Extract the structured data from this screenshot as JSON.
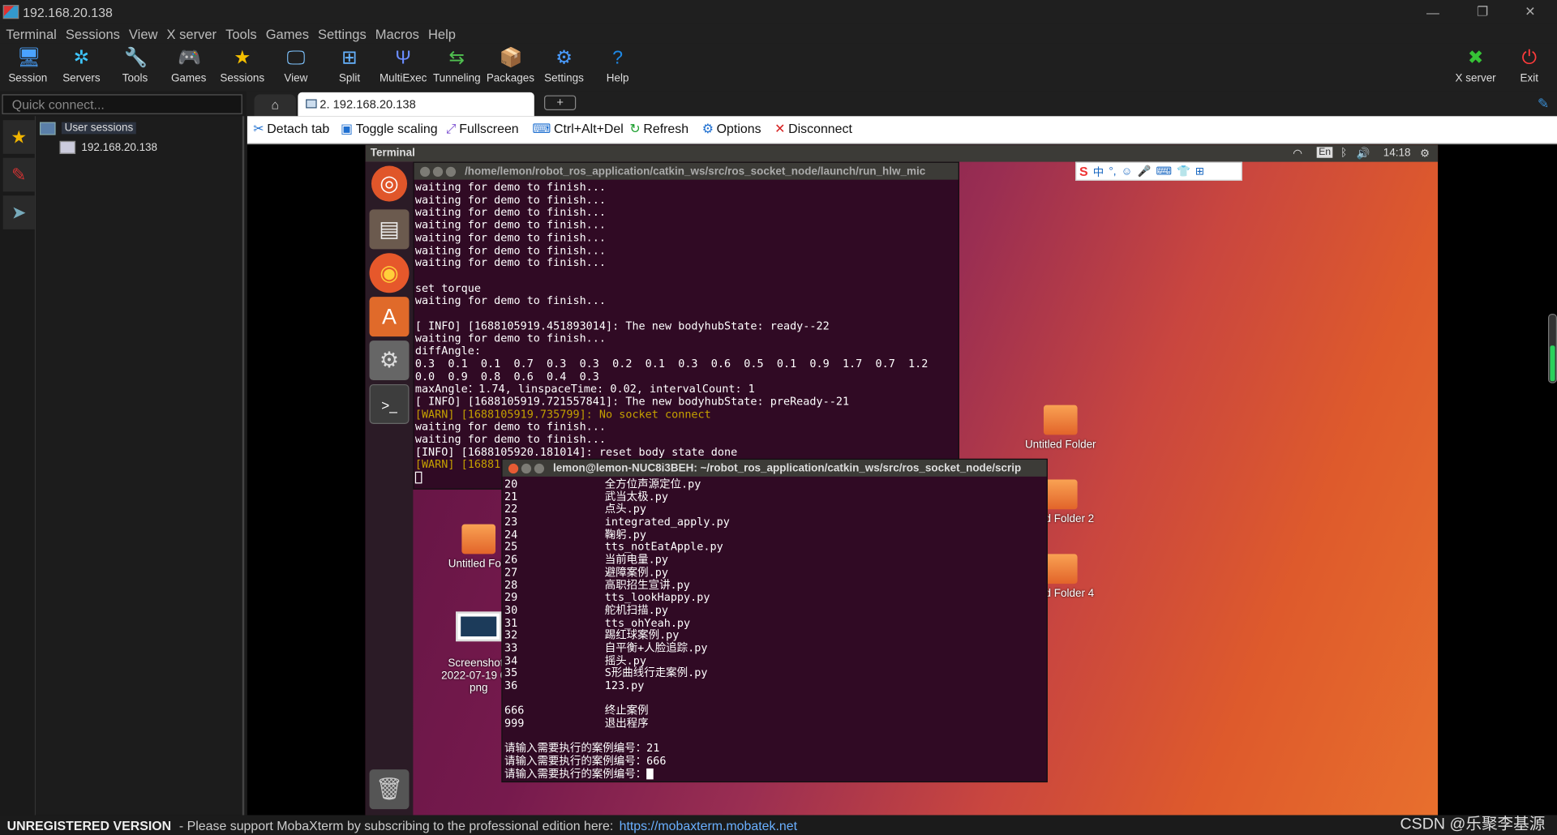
{
  "window": {
    "title": "192.168.20.138",
    "controls": [
      "—",
      "❐",
      "✕"
    ]
  },
  "menu": [
    "Terminal",
    "Sessions",
    "View",
    "X server",
    "Tools",
    "Games",
    "Settings",
    "Macros",
    "Help"
  ],
  "toolbar": [
    {
      "label": "Session",
      "icon": "session-icon",
      "glyph": "🖥"
    },
    {
      "label": "Servers",
      "icon": "servers-icon",
      "glyph": "✲"
    },
    {
      "label": "Tools",
      "icon": "tools-icon",
      "glyph": "🔧"
    },
    {
      "label": "Games",
      "icon": "games-icon",
      "glyph": "🎮"
    },
    {
      "label": "Sessions",
      "icon": "star-icon",
      "glyph": "★"
    },
    {
      "label": "View",
      "icon": "view-icon",
      "glyph": "🖵"
    },
    {
      "label": "Split",
      "icon": "split-icon",
      "glyph": "⊞"
    },
    {
      "label": "MultiExec",
      "icon": "multiexec-icon",
      "glyph": "Ψ"
    },
    {
      "label": "Tunneling",
      "icon": "tunneling-icon",
      "glyph": "⇆"
    },
    {
      "label": "Packages",
      "icon": "packages-icon",
      "glyph": "📦"
    },
    {
      "label": "Settings",
      "icon": "settings-icon",
      "glyph": "⚙"
    },
    {
      "label": "Help",
      "icon": "help-icon",
      "glyph": "?"
    }
  ],
  "toolbar_right": [
    {
      "label": "X server",
      "icon": "x-server-icon",
      "glyph": "✖"
    },
    {
      "label": "Exit",
      "icon": "exit-icon",
      "glyph": "⏻"
    }
  ],
  "quick_connect": {
    "placeholder": "Quick connect..."
  },
  "tabs": {
    "home": "⌂",
    "session": "2. 192.168.20.138",
    "plus": "+"
  },
  "sessions_panel": {
    "root": "User sessions",
    "items": [
      "192.168.20.138"
    ]
  },
  "session_toolbar": [
    {
      "label": "Detach tab",
      "glyph": "✂",
      "color": "#1e6fd0"
    },
    {
      "label": "Toggle scaling",
      "glyph": "▣",
      "color": "#1e6fd0"
    },
    {
      "label": "Fullscreen",
      "glyph": "⤢",
      "color": "#7b4fd0"
    },
    {
      "label": "Ctrl+Alt+Del",
      "glyph": "⌨",
      "color": "#1e6fd0"
    },
    {
      "label": "Refresh",
      "glyph": "↻",
      "color": "#1a9e2c"
    },
    {
      "label": "Options",
      "glyph": "⚙",
      "color": "#1e6fd0"
    },
    {
      "label": "Disconnect",
      "glyph": "✕",
      "color": "#d62020"
    }
  ],
  "remote": {
    "topbar_title": "Terminal",
    "indicators": {
      "lang": "En",
      "time": "14:18"
    },
    "ime": [
      "中",
      "°,",
      "☺",
      "🎤",
      "⌨",
      "👕",
      "⊞"
    ],
    "desktop_icons": [
      {
        "label": "Untitled Folder"
      },
      {
        "label": "ed Folder 2"
      },
      {
        "label": "ed Folder 4"
      },
      {
        "label": "Untitled Folc"
      },
      {
        "label": "Screenshot f\n2022-07-19 09-\npng"
      }
    ],
    "terminal1": {
      "title": "/home/lemon/robot_ros_application/catkin_ws/src/ros_socket_node/launch/run_hlw_mic",
      "lines": [
        {
          "t": "waiting for demo to finish..."
        },
        {
          "t": "waiting for demo to finish..."
        },
        {
          "t": "waiting for demo to finish..."
        },
        {
          "t": "waiting for demo to finish..."
        },
        {
          "t": "waiting for demo to finish..."
        },
        {
          "t": "waiting for demo to finish..."
        },
        {
          "t": "waiting for demo to finish..."
        },
        {
          "t": ""
        },
        {
          "t": "set torque"
        },
        {
          "t": "waiting for demo to finish..."
        },
        {
          "t": ""
        },
        {
          "t": "[ INFO] [1688105919.451893014]: The new bodyhubState: ready--22"
        },
        {
          "t": "waiting for demo to finish..."
        },
        {
          "t": "diffAngle:"
        },
        {
          "t": "0.3  0.1  0.1  0.7  0.3  0.3  0.2  0.1  0.3  0.6  0.5  0.1  0.9  1.7  0.7  1.2"
        },
        {
          "t": "0.0  0.9  0.8  0.6  0.4  0.3"
        },
        {
          "t": "maxAngle：1.74, linspaceTime: 0.02, intervalCount: 1"
        },
        {
          "t": "[ INFO] [1688105919.721557841]: The new bodyhubState: preReady--21"
        },
        {
          "t": "[WARN] [1688105919.735799]: No socket connect",
          "warn": true
        },
        {
          "t": "waiting for demo to finish..."
        },
        {
          "t": "waiting for demo to finish..."
        },
        {
          "t": "[INFO] [1688105920.181014]: reset body state done"
        },
        {
          "t": "[WARN] [16881",
          "warn": true
        }
      ]
    },
    "terminal2": {
      "title": "lemon@lemon-NUC8i3BEH: ~/robot_ros_application/catkin_ws/src/ros_socket_node/scrip",
      "rows": [
        {
          "n": "20",
          "name": "全方位声源定位.py"
        },
        {
          "n": "21",
          "name": "武当太极.py"
        },
        {
          "n": "22",
          "name": "点头.py"
        },
        {
          "n": "23",
          "name": "integrated_apply.py"
        },
        {
          "n": "24",
          "name": "鞠躬.py"
        },
        {
          "n": "25",
          "name": "tts_notEatApple.py"
        },
        {
          "n": "26",
          "name": "当前电量.py"
        },
        {
          "n": "27",
          "name": "避障案例.py"
        },
        {
          "n": "28",
          "name": "高职招生宣讲.py"
        },
        {
          "n": "29",
          "name": "tts_lookHappy.py"
        },
        {
          "n": "30",
          "name": "舵机扫描.py"
        },
        {
          "n": "31",
          "name": "tts_ohYeah.py"
        },
        {
          "n": "32",
          "name": "踢红球案例.py"
        },
        {
          "n": "33",
          "name": "自平衡+人脸追踪.py"
        },
        {
          "n": "34",
          "name": "摇头.py"
        },
        {
          "n": "35",
          "name": "S形曲线行走案例.py"
        },
        {
          "n": "36",
          "name": "123.py"
        },
        {
          "n": "",
          "name": ""
        },
        {
          "n": "666",
          "name": "终止案例"
        },
        {
          "n": "999",
          "name": "退出程序"
        },
        {
          "n": "",
          "name": ""
        }
      ],
      "prompts": [
        {
          "label": "请输入需要执行的案例编号：",
          "value": "21"
        },
        {
          "label": "请输入需要执行的案例编号：",
          "value": "666"
        },
        {
          "label": "请输入需要执行的案例编号：",
          "value": ""
        }
      ]
    }
  },
  "status": {
    "edition": "UNREGISTERED VERSION",
    "message": "-  Please support MobaXterm by subscribing to the professional edition here:",
    "link": "https://mobaxterm.mobatek.net"
  },
  "watermark": "CSDN @乐聚李基源"
}
